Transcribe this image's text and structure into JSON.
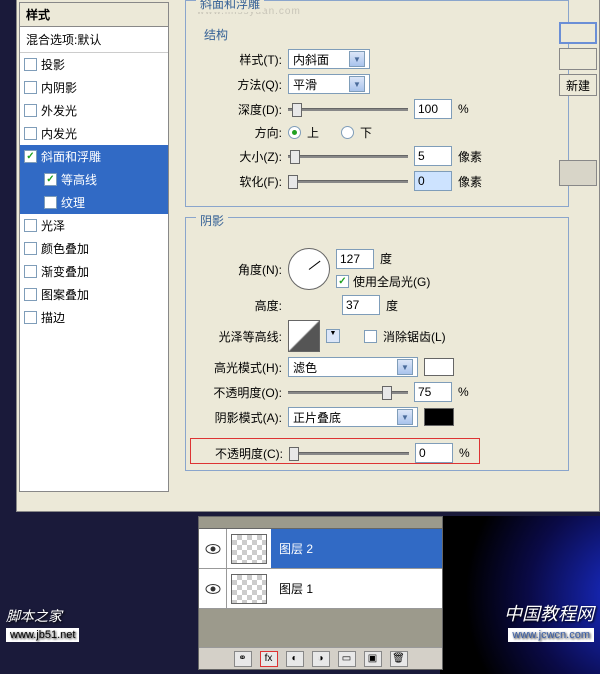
{
  "faint_url": "www.missyuan.com",
  "sidebar": {
    "header": "样式",
    "blend": "混合选项:默认",
    "items": [
      {
        "label": "投影",
        "checked": false,
        "active": false
      },
      {
        "label": "内阴影",
        "checked": false,
        "active": false
      },
      {
        "label": "外发光",
        "checked": false,
        "active": false
      },
      {
        "label": "内发光",
        "checked": false,
        "active": false
      },
      {
        "label": "斜面和浮雕",
        "checked": true,
        "active": true
      },
      {
        "label": "等高线",
        "checked": true,
        "active": true,
        "sub": true
      },
      {
        "label": "纹理",
        "checked": false,
        "active": true,
        "sub": true
      },
      {
        "label": "光泽",
        "checked": false,
        "active": false
      },
      {
        "label": "颜色叠加",
        "checked": false,
        "active": false
      },
      {
        "label": "渐变叠加",
        "checked": false,
        "active": false
      },
      {
        "label": "图案叠加",
        "checked": false,
        "active": false
      },
      {
        "label": "描边",
        "checked": false,
        "active": false
      }
    ]
  },
  "panel_title": "斜面和浮雕",
  "struct": {
    "title": "结构",
    "style_lbl": "样式(T):",
    "style_val": "内斜面",
    "method_lbl": "方法(Q):",
    "method_val": "平滑",
    "depth_lbl": "深度(D):",
    "depth_val": "100",
    "depth_unit": "%",
    "dir_lbl": "方向:",
    "up": "上",
    "down": "下",
    "size_lbl": "大小(Z):",
    "size_val": "5",
    "size_unit": "像素",
    "soften_lbl": "软化(F):",
    "soften_val": "0",
    "soften_unit": "像素"
  },
  "shadow": {
    "title": "阴影",
    "angle_lbl": "角度(N):",
    "angle_val": "127",
    "angle_unit": "度",
    "global": "使用全局光(G)",
    "alt_lbl": "高度:",
    "alt_val": "37",
    "alt_unit": "度",
    "gloss_lbl": "光泽等高线:",
    "aa": "消除锯齿(L)",
    "hmode_lbl": "高光模式(H):",
    "hmode_val": "滤色",
    "hopac_lbl": "不透明度(O):",
    "hopac_val": "75",
    "pct": "%",
    "smode_lbl": "阴影模式(A):",
    "smode_val": "正片叠底",
    "sopac_lbl": "不透明度(C):",
    "sopac_val": "0"
  },
  "buttons": {
    "new": "新建"
  },
  "layers": {
    "items": [
      {
        "name": "图层 2",
        "active": true
      },
      {
        "name": "图层 1",
        "active": false
      }
    ]
  },
  "watermarks": {
    "left_title": "脚本之家",
    "left_url": "www.jb51.net",
    "right_title": "中国教程网",
    "right_url": "www.jcwcn.com"
  }
}
